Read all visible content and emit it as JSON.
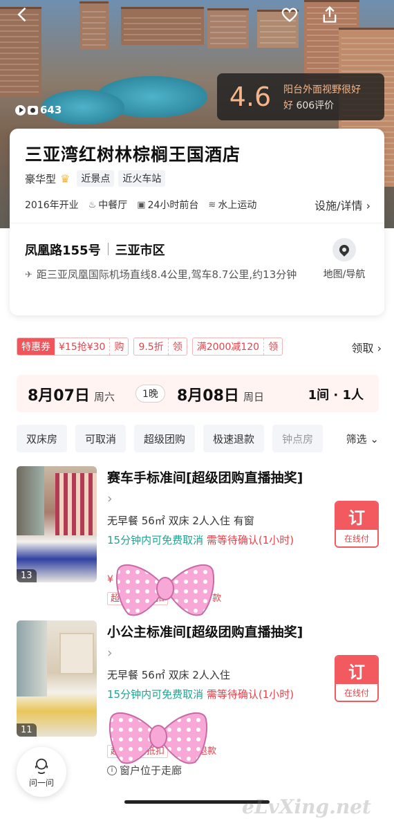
{
  "hero": {
    "photo_count": "643",
    "rating_score": "4.6",
    "rating_comment": "阳台外面视野很好",
    "rating_level": "好",
    "review_count": "606评价"
  },
  "hotel": {
    "name": "三亚湾红树林棕榈王国酒店",
    "level": "豪华型",
    "tags": [
      "近景点",
      "近火车站"
    ],
    "opened": "2016年开业",
    "facilities": [
      {
        "icon": "restaurant-icon",
        "label": "中餐厅"
      },
      {
        "icon": "front-desk-icon",
        "label": "24小时前台"
      },
      {
        "icon": "water-sports-icon",
        "label": "水上运动"
      }
    ],
    "facility_link": "设施/详情",
    "address_road": "凤凰路155号",
    "address_area": "三亚市区",
    "distance": "距三亚凤凰国际机场直线8.4公里,驾车8.7公里,约13分钟",
    "map_label": "地图/导航"
  },
  "coupons": {
    "special_tag": "特惠券",
    "special_value": "¥15抢¥30",
    "special_action": "购",
    "items": [
      {
        "value": "9.5折",
        "action": "领"
      },
      {
        "value": "满2000减120",
        "action": "领"
      }
    ],
    "link": "领取"
  },
  "dates": {
    "checkin": "8月07日",
    "checkin_week": "周六",
    "nights": "1晚",
    "checkout": "8月08日",
    "checkout_week": "周日",
    "guests": "1间 · 1人"
  },
  "filters": {
    "chips": [
      "双床房",
      "可取消",
      "超级团购",
      "极速退款",
      "钟点房"
    ],
    "filter_label": "筛选"
  },
  "rooms": [
    {
      "title": "赛车手标准间[超级团购直播抽奖]",
      "features": "无早餐 56㎡ 双床 2人入住 有窗",
      "cancel": "15分钟内可免费取消",
      "confirm": "需等待确认(1小时)",
      "photo_count": "13",
      "price_hint": "¥",
      "promo": "超级团购抵扣",
      "promo_tail": "款",
      "book_label": "订",
      "pay_label": "在线付"
    },
    {
      "title": "小公主标准间[超级团购直播抽奖]",
      "features": "无早餐 56㎡ 双床 2人入住",
      "cancel": "15分钟内可免费取消",
      "confirm": "需等待确认(1小时)",
      "photo_count": "11",
      "promo": "超级团购抵扣",
      "promo_tail": "退款",
      "book_label": "订",
      "pay_label": "在线付",
      "note": "窗户位于走廊"
    }
  ],
  "ask_label": "问一问",
  "watermark": "eLvXing.net"
}
